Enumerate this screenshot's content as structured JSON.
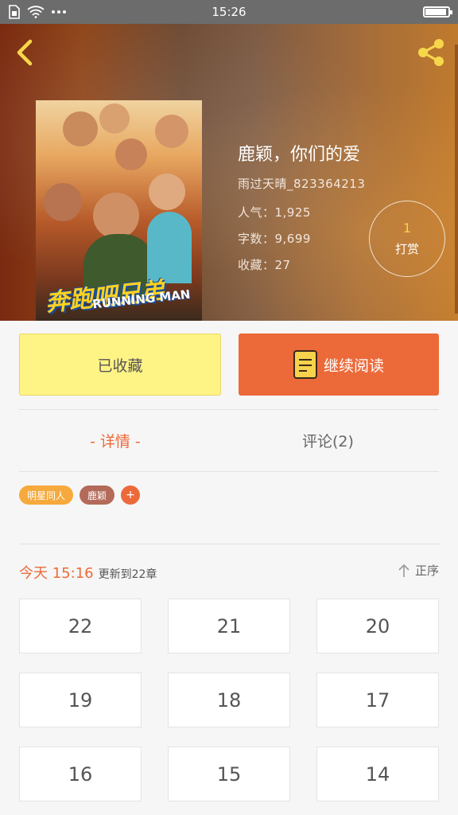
{
  "status_bar": {
    "time": "15:26",
    "icons": [
      "sim-icon",
      "wifi-icon",
      "more-dots-icon",
      "battery-icon"
    ]
  },
  "header": {
    "back_icon": "chevron-left-icon",
    "share_icon": "share-icon"
  },
  "book": {
    "title": "鹿颖，你们的爱",
    "author": "雨过天晴_823364213",
    "popularity": "人气：1,925",
    "word_count": "字数：9,699",
    "favorites": "收藏：27",
    "cover_logo_cn": "奔跑吧兄弟",
    "cover_logo_en": "RUNNING MAN"
  },
  "tip": {
    "count": "1",
    "label": "打赏"
  },
  "actions": {
    "favorite_label": "已收藏",
    "continue_label": "继续阅读"
  },
  "tabs": [
    {
      "label": "- 详情 -",
      "active": true
    },
    {
      "label": "评论(2)",
      "active": false
    }
  ],
  "tags": [
    {
      "label": "明星同人"
    },
    {
      "label": "鹿颖"
    },
    {
      "label": "+"
    }
  ],
  "update": {
    "time": "今天 15:16",
    "text": "更新到22章",
    "sort_label": "正序"
  },
  "chapters": [
    "22",
    "21",
    "20",
    "19",
    "18",
    "17",
    "16",
    "15",
    "14"
  ],
  "colors": {
    "accent": "#ec6a3a",
    "favorite_bg": "#fef385",
    "tag_yellow": "#f6a93c",
    "tag_brown": "#b46a59"
  }
}
